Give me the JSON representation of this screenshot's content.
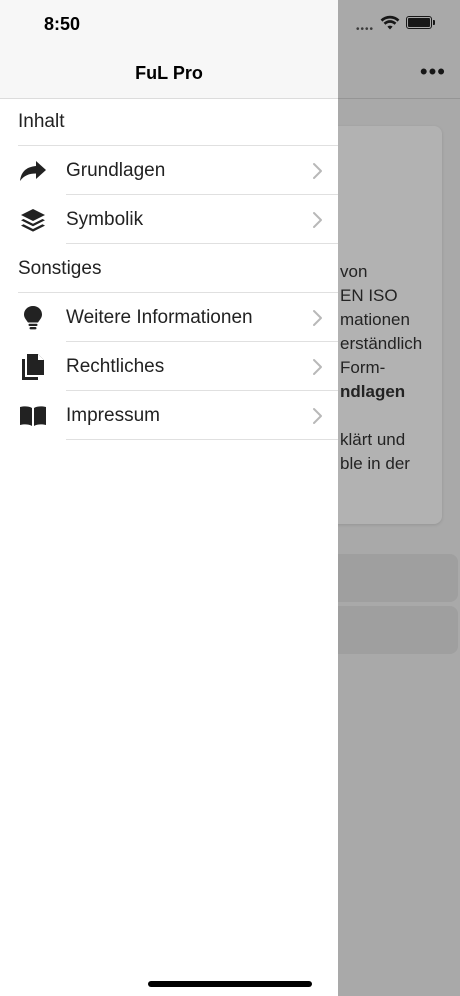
{
  "status": {
    "time": "8:50"
  },
  "drawer": {
    "title": "FuL Pro",
    "sections": [
      {
        "header": "Inhalt",
        "items": [
          {
            "label": "Grundlagen",
            "icon": "share-arrow-icon"
          },
          {
            "label": "Symbolik",
            "icon": "layers-icon"
          }
        ]
      },
      {
        "header": "Sonstiges",
        "items": [
          {
            "label": "Weitere Informationen",
            "icon": "lightbulb-icon"
          },
          {
            "label": "Rechtliches",
            "icon": "documents-icon"
          },
          {
            "label": "Impressum",
            "icon": "book-icon"
          }
        ]
      }
    ]
  },
  "background": {
    "more_label": "•••",
    "card_lines": [
      "von",
      "EN ISO",
      "mationen",
      "erständlich",
      "Form-",
      "ndlagen",
      "klärt und",
      "ble in der"
    ]
  },
  "colors": {
    "accent": "#222222",
    "dim_overlay": "rgba(0,0,0,0.30)"
  }
}
